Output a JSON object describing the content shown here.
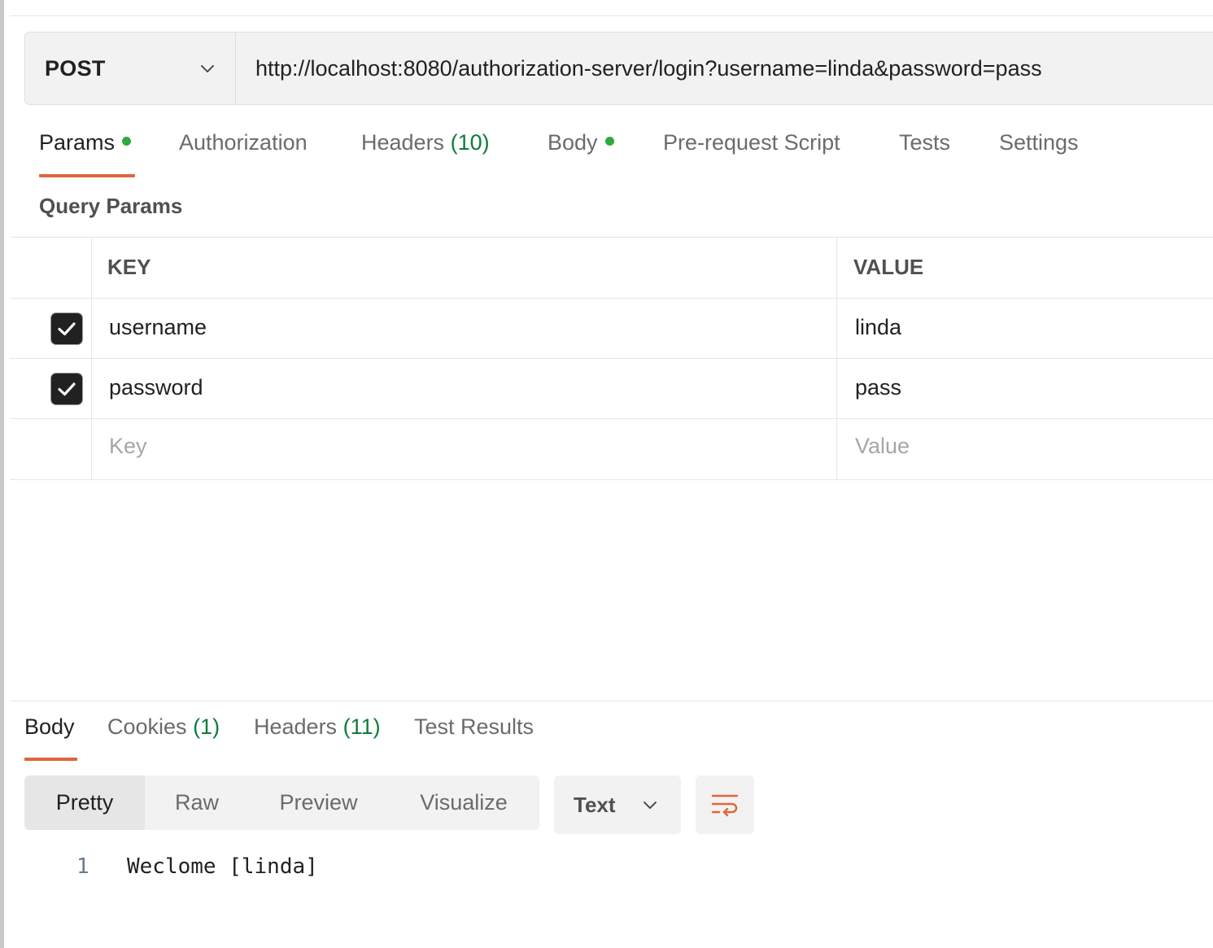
{
  "request": {
    "method": "POST",
    "url": "http://localhost:8080/authorization-server/login?username=linda&password=pass"
  },
  "request_tabs": [
    {
      "label": "Params",
      "count": "",
      "dot": true,
      "active": true
    },
    {
      "label": "Authorization",
      "count": "",
      "dot": false,
      "active": false
    },
    {
      "label": "Headers",
      "count": "(10)",
      "dot": false,
      "active": false
    },
    {
      "label": "Body",
      "count": "",
      "dot": true,
      "active": false
    },
    {
      "label": "Pre-request Script",
      "count": "",
      "dot": false,
      "active": false
    },
    {
      "label": "Tests",
      "count": "",
      "dot": false,
      "active": false
    },
    {
      "label": "Settings",
      "count": "",
      "dot": false,
      "active": false
    }
  ],
  "query_params": {
    "title": "Query Params",
    "key_header": "KEY",
    "value_header": "VALUE",
    "rows": [
      {
        "checked": true,
        "key": "username",
        "value": "linda"
      },
      {
        "checked": true,
        "key": "password",
        "value": "pass"
      }
    ],
    "key_placeholder": "Key",
    "value_placeholder": "Value"
  },
  "response_tabs": [
    {
      "label": "Body",
      "count": "",
      "active": true
    },
    {
      "label": "Cookies",
      "count": "(1)",
      "active": false
    },
    {
      "label": "Headers",
      "count": "(11)",
      "active": false
    },
    {
      "label": "Test Results",
      "count": "",
      "active": false
    }
  ],
  "view_modes": [
    "Pretty",
    "Raw",
    "Preview",
    "Visualize"
  ],
  "active_view": "Pretty",
  "format": "Text",
  "response_body": [
    {
      "line": "1",
      "text": "Weclome [linda]"
    }
  ],
  "colors": {
    "accent": "#e0663a",
    "dot": "#2faa3d",
    "count": "#0e7b3c"
  },
  "icons": {
    "method_dropdown": "chevron-down-icon",
    "format_dropdown": "chevron-down-icon",
    "wrap": "wrap-lines-icon",
    "checkbox": "checkmark-icon"
  }
}
